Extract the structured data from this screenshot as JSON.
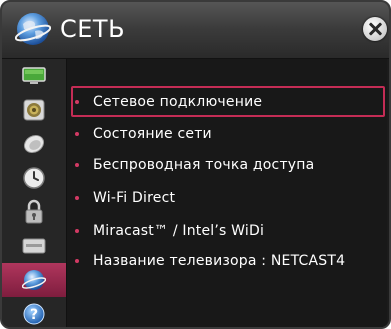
{
  "header": {
    "title": "СЕТЬ",
    "icon": "network-globe-icon"
  },
  "sidebar": {
    "items": [
      {
        "icon": "picture-monitor-icon"
      },
      {
        "icon": "audio-speaker-icon"
      },
      {
        "icon": "satellite-dish-icon"
      },
      {
        "icon": "clock-icon"
      },
      {
        "icon": "lock-icon"
      },
      {
        "icon": "options-box-icon"
      },
      {
        "icon": "network-globe-icon",
        "active": true
      },
      {
        "icon": "help-icon",
        "glyph": "?"
      }
    ]
  },
  "menu": {
    "items": [
      {
        "label": "Сетевое подключение",
        "selected": true
      },
      {
        "label": "Состояние сети"
      },
      {
        "label": "Беспроводная точка доступа"
      },
      {
        "label": "Wi-Fi Direct"
      },
      {
        "label": "Miracast™ / Intel’s WiDi"
      },
      {
        "label": "Название телевизора : NETCAST4"
      }
    ]
  },
  "colors": {
    "accent": "#c42c55",
    "active_bg": "#9e2a50",
    "panel_bg": "#181818",
    "text": "#ffffff"
  }
}
